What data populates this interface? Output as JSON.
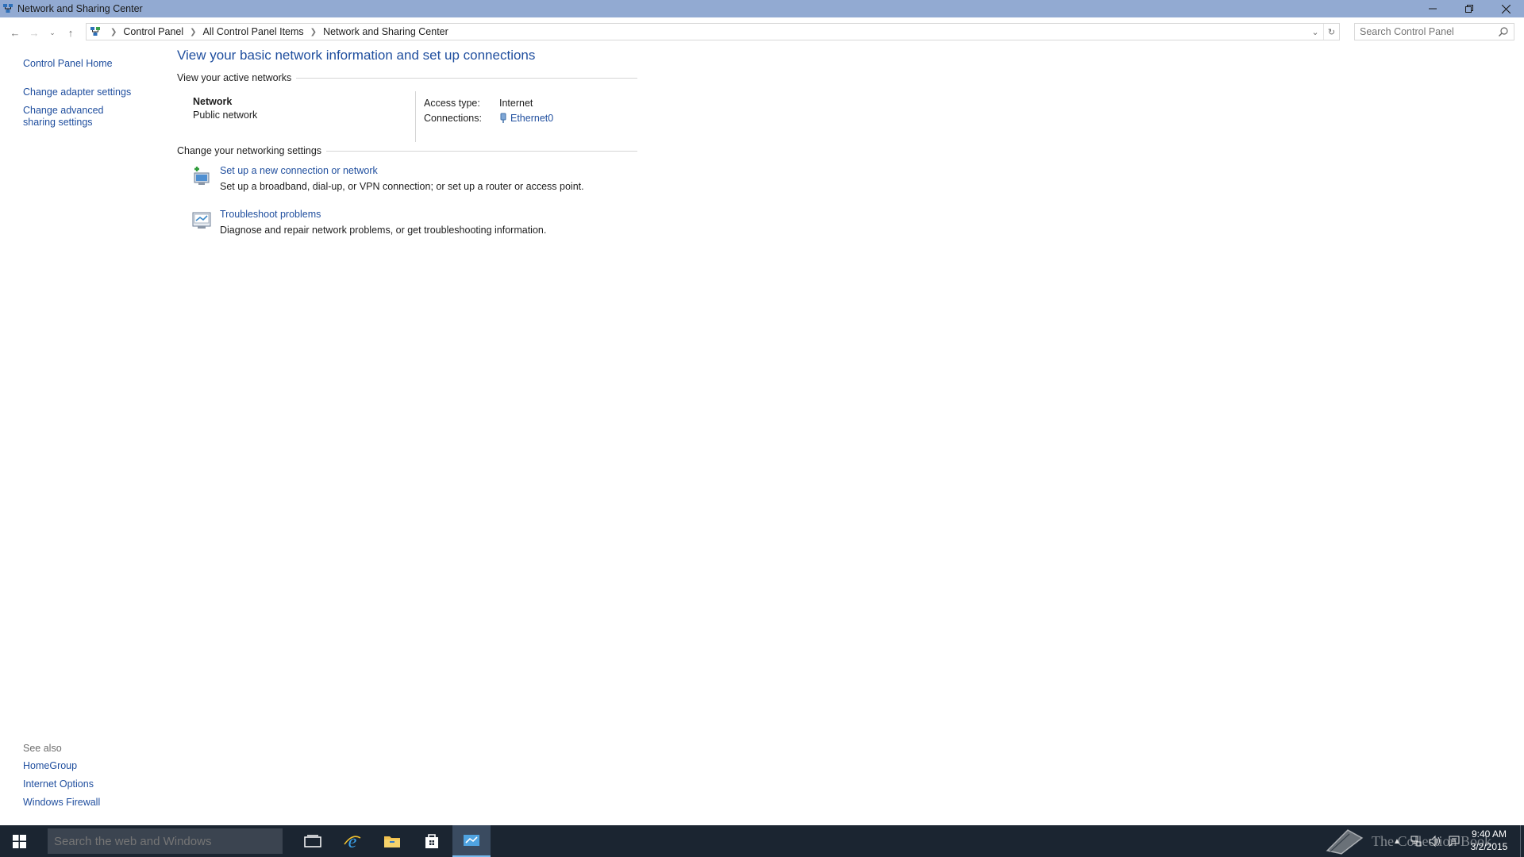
{
  "window": {
    "title": "Network and Sharing Center",
    "controls": {
      "minimize": "minimize-icon",
      "restore": "restore-icon",
      "close": "close-icon"
    }
  },
  "address": {
    "crumbs": [
      "Control Panel",
      "All Control Panel Items",
      "Network and Sharing Center"
    ],
    "search_placeholder": "Search Control Panel"
  },
  "leftpane": {
    "links": [
      "Control Panel Home",
      "Change adapter settings",
      "Change advanced sharing settings"
    ],
    "see_also_label": "See also",
    "see_also": [
      "HomeGroup",
      "Internet Options",
      "Windows Firewall"
    ]
  },
  "main": {
    "title": "View your basic network information and set up connections",
    "active_section": "View your active networks",
    "network": {
      "name": "Network",
      "type": "Public network",
      "access_type_label": "Access type:",
      "access_type_value": "Internet",
      "connections_label": "Connections:",
      "connections_value": "Ethernet0"
    },
    "settings_section": "Change your networking settings",
    "tasks": [
      {
        "link": "Set up a new connection or network",
        "desc": "Set up a broadband, dial-up, or VPN connection; or set up a router or access point."
      },
      {
        "link": "Troubleshoot problems",
        "desc": "Diagnose and repair network problems, or get troubleshooting information."
      }
    ]
  },
  "taskbar": {
    "search_placeholder": "Search the web and Windows",
    "watermark": "The Collection Book",
    "time": "9:40 AM",
    "date": "3/2/2015"
  }
}
